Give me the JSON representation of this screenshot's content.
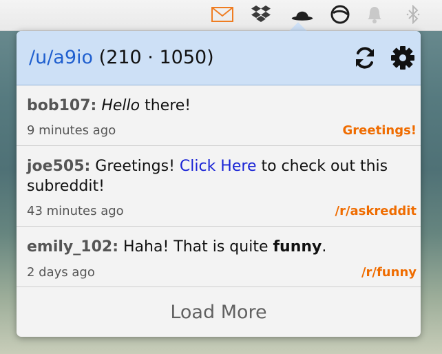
{
  "menubar": {
    "icons": [
      "mail-icon",
      "dropbox-icon",
      "bowler-hat-icon",
      "sync-circle-icon",
      "bell-icon",
      "bluetooth-icon"
    ],
    "mail_color": "#ef7d22"
  },
  "header": {
    "username": "/u/a9io",
    "karma": "(210 · 1050)",
    "refresh_icon": "refresh-icon",
    "settings_icon": "gear-icon"
  },
  "messages": [
    {
      "author": "bob107:",
      "parts": [
        {
          "text": "Hello",
          "style": "italic"
        },
        {
          "text": " there!",
          "style": "normal"
        }
      ],
      "time": "9 minutes ago",
      "subject": "Greetings!"
    },
    {
      "author": "joe505:",
      "parts": [
        {
          "text": " Greetings! ",
          "style": "normal"
        },
        {
          "text": "Click Here",
          "style": "link"
        },
        {
          "text": " to check out this subreddit!",
          "style": "normal"
        }
      ],
      "time": "43 minutes ago",
      "subject": "/r/askreddit"
    },
    {
      "author": "emily_102:",
      "parts": [
        {
          "text": " Haha! That is quite ",
          "style": "normal"
        },
        {
          "text": "funny",
          "style": "bold"
        },
        {
          "text": ".",
          "style": "normal"
        }
      ],
      "time": "2 days ago",
      "subject": "/r/funny"
    }
  ],
  "load_more_label": "Load More",
  "colors": {
    "header_bg": "#cde0f6",
    "username": "#1f5fcf",
    "subject": "#ef6c00",
    "link": "#1a24d6"
  }
}
